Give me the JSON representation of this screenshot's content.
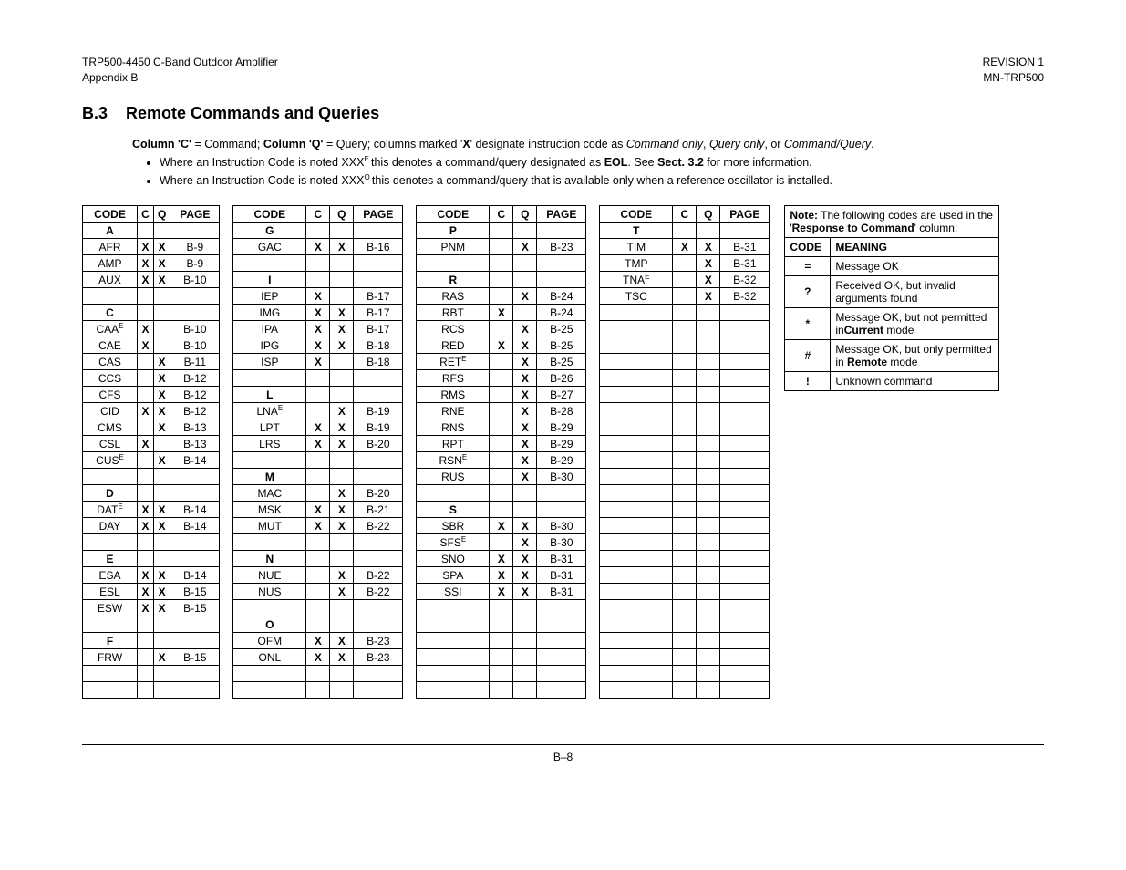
{
  "header": {
    "left1": "TRP500-4450 C-Band Outdoor Amplifier",
    "left2": "Appendix B",
    "right1": "REVISION 1",
    "right2": "MN-TRP500"
  },
  "section": {
    "number": "B.3",
    "title": "Remote Commands and Queries"
  },
  "intro": {
    "line1_prefix": "Column 'C' ",
    "line1_mid1": "= Command; ",
    "line1_b2": "Column 'Q' ",
    "line1_mid2": "= Query; columns marked '",
    "line1_x": "X",
    "line1_mid3": "' designate instruction code as ",
    "line1_i1": "Command only",
    "line1_c1": ", ",
    "line1_i2": "Query only",
    "line1_c2": ", or ",
    "line1_i3": "Command/Query",
    "line1_end": ".",
    "bullet1a": "Where an Instruction Code is noted XXX",
    "bullet1sup": "E ",
    "bullet1b": "this denotes a command/query designated as ",
    "bullet1eol": "EOL",
    "bullet1c": ". See ",
    "bullet1sect": "Sect. 3.2",
    "bullet1d": " for more information.",
    "bullet2a": "Where an Instruction Code is noted XXX",
    "bullet2sup": "O ",
    "bullet2b": "this denotes a command/query that is available only when a reference oscillator is installed."
  },
  "cols": {
    "headers": [
      "CODE",
      "C",
      "Q",
      "PAGE"
    ]
  },
  "col1": [
    {
      "code": "A",
      "b": true
    },
    {
      "code": "AFR",
      "c": "X",
      "q": "X",
      "page": "B-9"
    },
    {
      "code": "AMP",
      "c": "X",
      "q": "X",
      "page": "B-9"
    },
    {
      "code": "AUX",
      "c": "X",
      "q": "X",
      "page": "B-10"
    },
    {
      "code": ""
    },
    {
      "code": "C",
      "b": true
    },
    {
      "code": "CAA",
      "sup": "E",
      "c": "X",
      "page": "B-10"
    },
    {
      "code": "CAE",
      "c": "X",
      "page": "B-10"
    },
    {
      "code": "CAS",
      "q": "X",
      "page": "B-11"
    },
    {
      "code": "CCS",
      "q": "X",
      "page": "B-12"
    },
    {
      "code": "CFS",
      "q": "X",
      "page": "B-12"
    },
    {
      "code": "CID",
      "c": "X",
      "q": "X",
      "page": "B-12"
    },
    {
      "code": "CMS",
      "q": "X",
      "page": "B-13"
    },
    {
      "code": "CSL",
      "c": "X",
      "page": "B-13"
    },
    {
      "code": "CUS",
      "sup": "E",
      "q": "X",
      "page": "B-14"
    },
    {
      "code": ""
    },
    {
      "code": "D",
      "b": true
    },
    {
      "code": "DAT",
      "sup": "E",
      "c": "X",
      "q": "X",
      "page": "B-14"
    },
    {
      "code": "DAY",
      "c": "X",
      "q": "X",
      "page": "B-14"
    },
    {
      "code": ""
    },
    {
      "code": "E",
      "b": true
    },
    {
      "code": "ESA",
      "c": "X",
      "q": "X",
      "page": "B-14"
    },
    {
      "code": "ESL",
      "c": "X",
      "q": "X",
      "page": "B-15"
    },
    {
      "code": "ESW",
      "c": "X",
      "q": "X",
      "page": "B-15"
    },
    {
      "code": ""
    },
    {
      "code": "F",
      "b": true
    },
    {
      "code": "FRW",
      "q": "X",
      "page": "B-15"
    },
    {
      "code": ""
    },
    {
      "code": ""
    }
  ],
  "col2": [
    {
      "code": "G",
      "b": true
    },
    {
      "code": "GAC",
      "c": "X",
      "q": "X",
      "page": "B-16"
    },
    {
      "code": ""
    },
    {
      "code": "I",
      "b": true
    },
    {
      "code": "IEP",
      "c": "X",
      "page": "B-17"
    },
    {
      "code": "IMG",
      "c": "X",
      "q": "X",
      "page": "B-17"
    },
    {
      "code": "IPA",
      "c": "X",
      "q": "X",
      "page": "B-17"
    },
    {
      "code": "IPG",
      "c": "X",
      "q": "X",
      "page": "B-18"
    },
    {
      "code": "ISP",
      "c": "X",
      "page": "B-18"
    },
    {
      "code": ""
    },
    {
      "code": "L",
      "b": true
    },
    {
      "code": "LNA",
      "sup": "E",
      "q": "X",
      "page": "B-19"
    },
    {
      "code": "LPT",
      "c": "X",
      "q": "X",
      "page": "B-19"
    },
    {
      "code": "LRS",
      "c": "X",
      "q": "X",
      "page": "B-20"
    },
    {
      "code": ""
    },
    {
      "code": "M",
      "b": true
    },
    {
      "code": "MAC",
      "q": "X",
      "page": "B-20"
    },
    {
      "code": "MSK",
      "c": "X",
      "q": "X",
      "page": "B-21"
    },
    {
      "code": "MUT",
      "c": "X",
      "q": "X",
      "page": "B-22"
    },
    {
      "code": ""
    },
    {
      "code": "N",
      "b": true
    },
    {
      "code": "NUE",
      "q": "X",
      "page": "B-22"
    },
    {
      "code": "NUS",
      "q": "X",
      "page": "B-22"
    },
    {
      "code": ""
    },
    {
      "code": "O",
      "b": true
    },
    {
      "code": "OFM",
      "c": "X",
      "q": "X",
      "page": "B-23"
    },
    {
      "code": "ONL",
      "c": "X",
      "q": "X",
      "page": "B-23"
    },
    {
      "code": ""
    },
    {
      "code": ""
    }
  ],
  "col3": [
    {
      "code": "P",
      "b": true
    },
    {
      "code": "PNM",
      "q": "X",
      "page": "B-23"
    },
    {
      "code": ""
    },
    {
      "code": "R",
      "b": true
    },
    {
      "code": "RAS",
      "q": "X",
      "page": "B-24"
    },
    {
      "code": "RBT",
      "c": "X",
      "page": "B-24"
    },
    {
      "code": "RCS",
      "q": "X",
      "page": "B-25"
    },
    {
      "code": "RED",
      "c": "X",
      "q": "X",
      "page": "B-25"
    },
    {
      "code": "RET",
      "sup": "E",
      "q": "X",
      "page": "B-25"
    },
    {
      "code": "RFS",
      "q": "X",
      "page": "B-26"
    },
    {
      "code": "RMS",
      "q": "X",
      "page": "B-27"
    },
    {
      "code": "RNE",
      "q": "X",
      "page": "B-28"
    },
    {
      "code": "RNS",
      "q": "X",
      "page": "B-29"
    },
    {
      "code": "RPT",
      "q": "X",
      "page": "B-29"
    },
    {
      "code": "RSN",
      "sup": "E",
      "q": "X",
      "page": "B-29"
    },
    {
      "code": "RUS",
      "q": "X",
      "page": "B-30"
    },
    {
      "code": ""
    },
    {
      "code": "S",
      "b": true
    },
    {
      "code": "SBR",
      "c": "X",
      "q": "X",
      "page": "B-30"
    },
    {
      "code": "SFS",
      "sup": "E",
      "q": "X",
      "page": "B-30"
    },
    {
      "code": "SNO",
      "c": "X",
      "q": "X",
      "page": "B-31"
    },
    {
      "code": "SPA",
      "c": "X",
      "q": "X",
      "page": "B-31"
    },
    {
      "code": "SSI",
      "c": "X",
      "q": "X",
      "page": "B-31"
    },
    {
      "code": ""
    },
    {
      "code": ""
    },
    {
      "code": ""
    },
    {
      "code": ""
    },
    {
      "code": ""
    },
    {
      "code": ""
    }
  ],
  "col4": [
    {
      "code": "T",
      "b": true
    },
    {
      "code": "TIM",
      "c": "X",
      "q": "X",
      "page": "B-31"
    },
    {
      "code": "TMP",
      "q": "X",
      "page": "B-31"
    },
    {
      "code": "TNA",
      "sup": "E",
      "q": "X",
      "page": "B-32"
    },
    {
      "code": "TSC",
      "q": "X",
      "page": "B-32"
    },
    {
      "code": ""
    },
    {
      "code": ""
    },
    {
      "code": ""
    },
    {
      "code": ""
    },
    {
      "code": ""
    },
    {
      "code": ""
    },
    {
      "code": ""
    },
    {
      "code": ""
    },
    {
      "code": ""
    },
    {
      "code": ""
    },
    {
      "code": ""
    },
    {
      "code": ""
    },
    {
      "code": ""
    },
    {
      "code": ""
    },
    {
      "code": ""
    },
    {
      "code": ""
    },
    {
      "code": ""
    },
    {
      "code": ""
    },
    {
      "code": ""
    },
    {
      "code": ""
    },
    {
      "code": ""
    },
    {
      "code": ""
    },
    {
      "code": ""
    },
    {
      "code": ""
    }
  ],
  "note": {
    "caption1": "Note:",
    "caption2": " The following codes are used in the '",
    "caption3": "Response to Command",
    "caption4": "' column:",
    "hcode": "CODE",
    "hmeaning": "MEANING",
    "rows": [
      {
        "c": "=",
        "m": "Message OK"
      },
      {
        "c": "?",
        "m": "Received OK, but invalid arguments found"
      },
      {
        "c": "*",
        "m": "Message OK, but not permitted in",
        "mb": "Current",
        "m2": " mode"
      },
      {
        "c": "#",
        "m": "Message OK, but only permitted in ",
        "mb": "Remote",
        "m2": " mode"
      },
      {
        "c": "!",
        "m": "Unknown command"
      }
    ]
  },
  "footer": "B–8"
}
